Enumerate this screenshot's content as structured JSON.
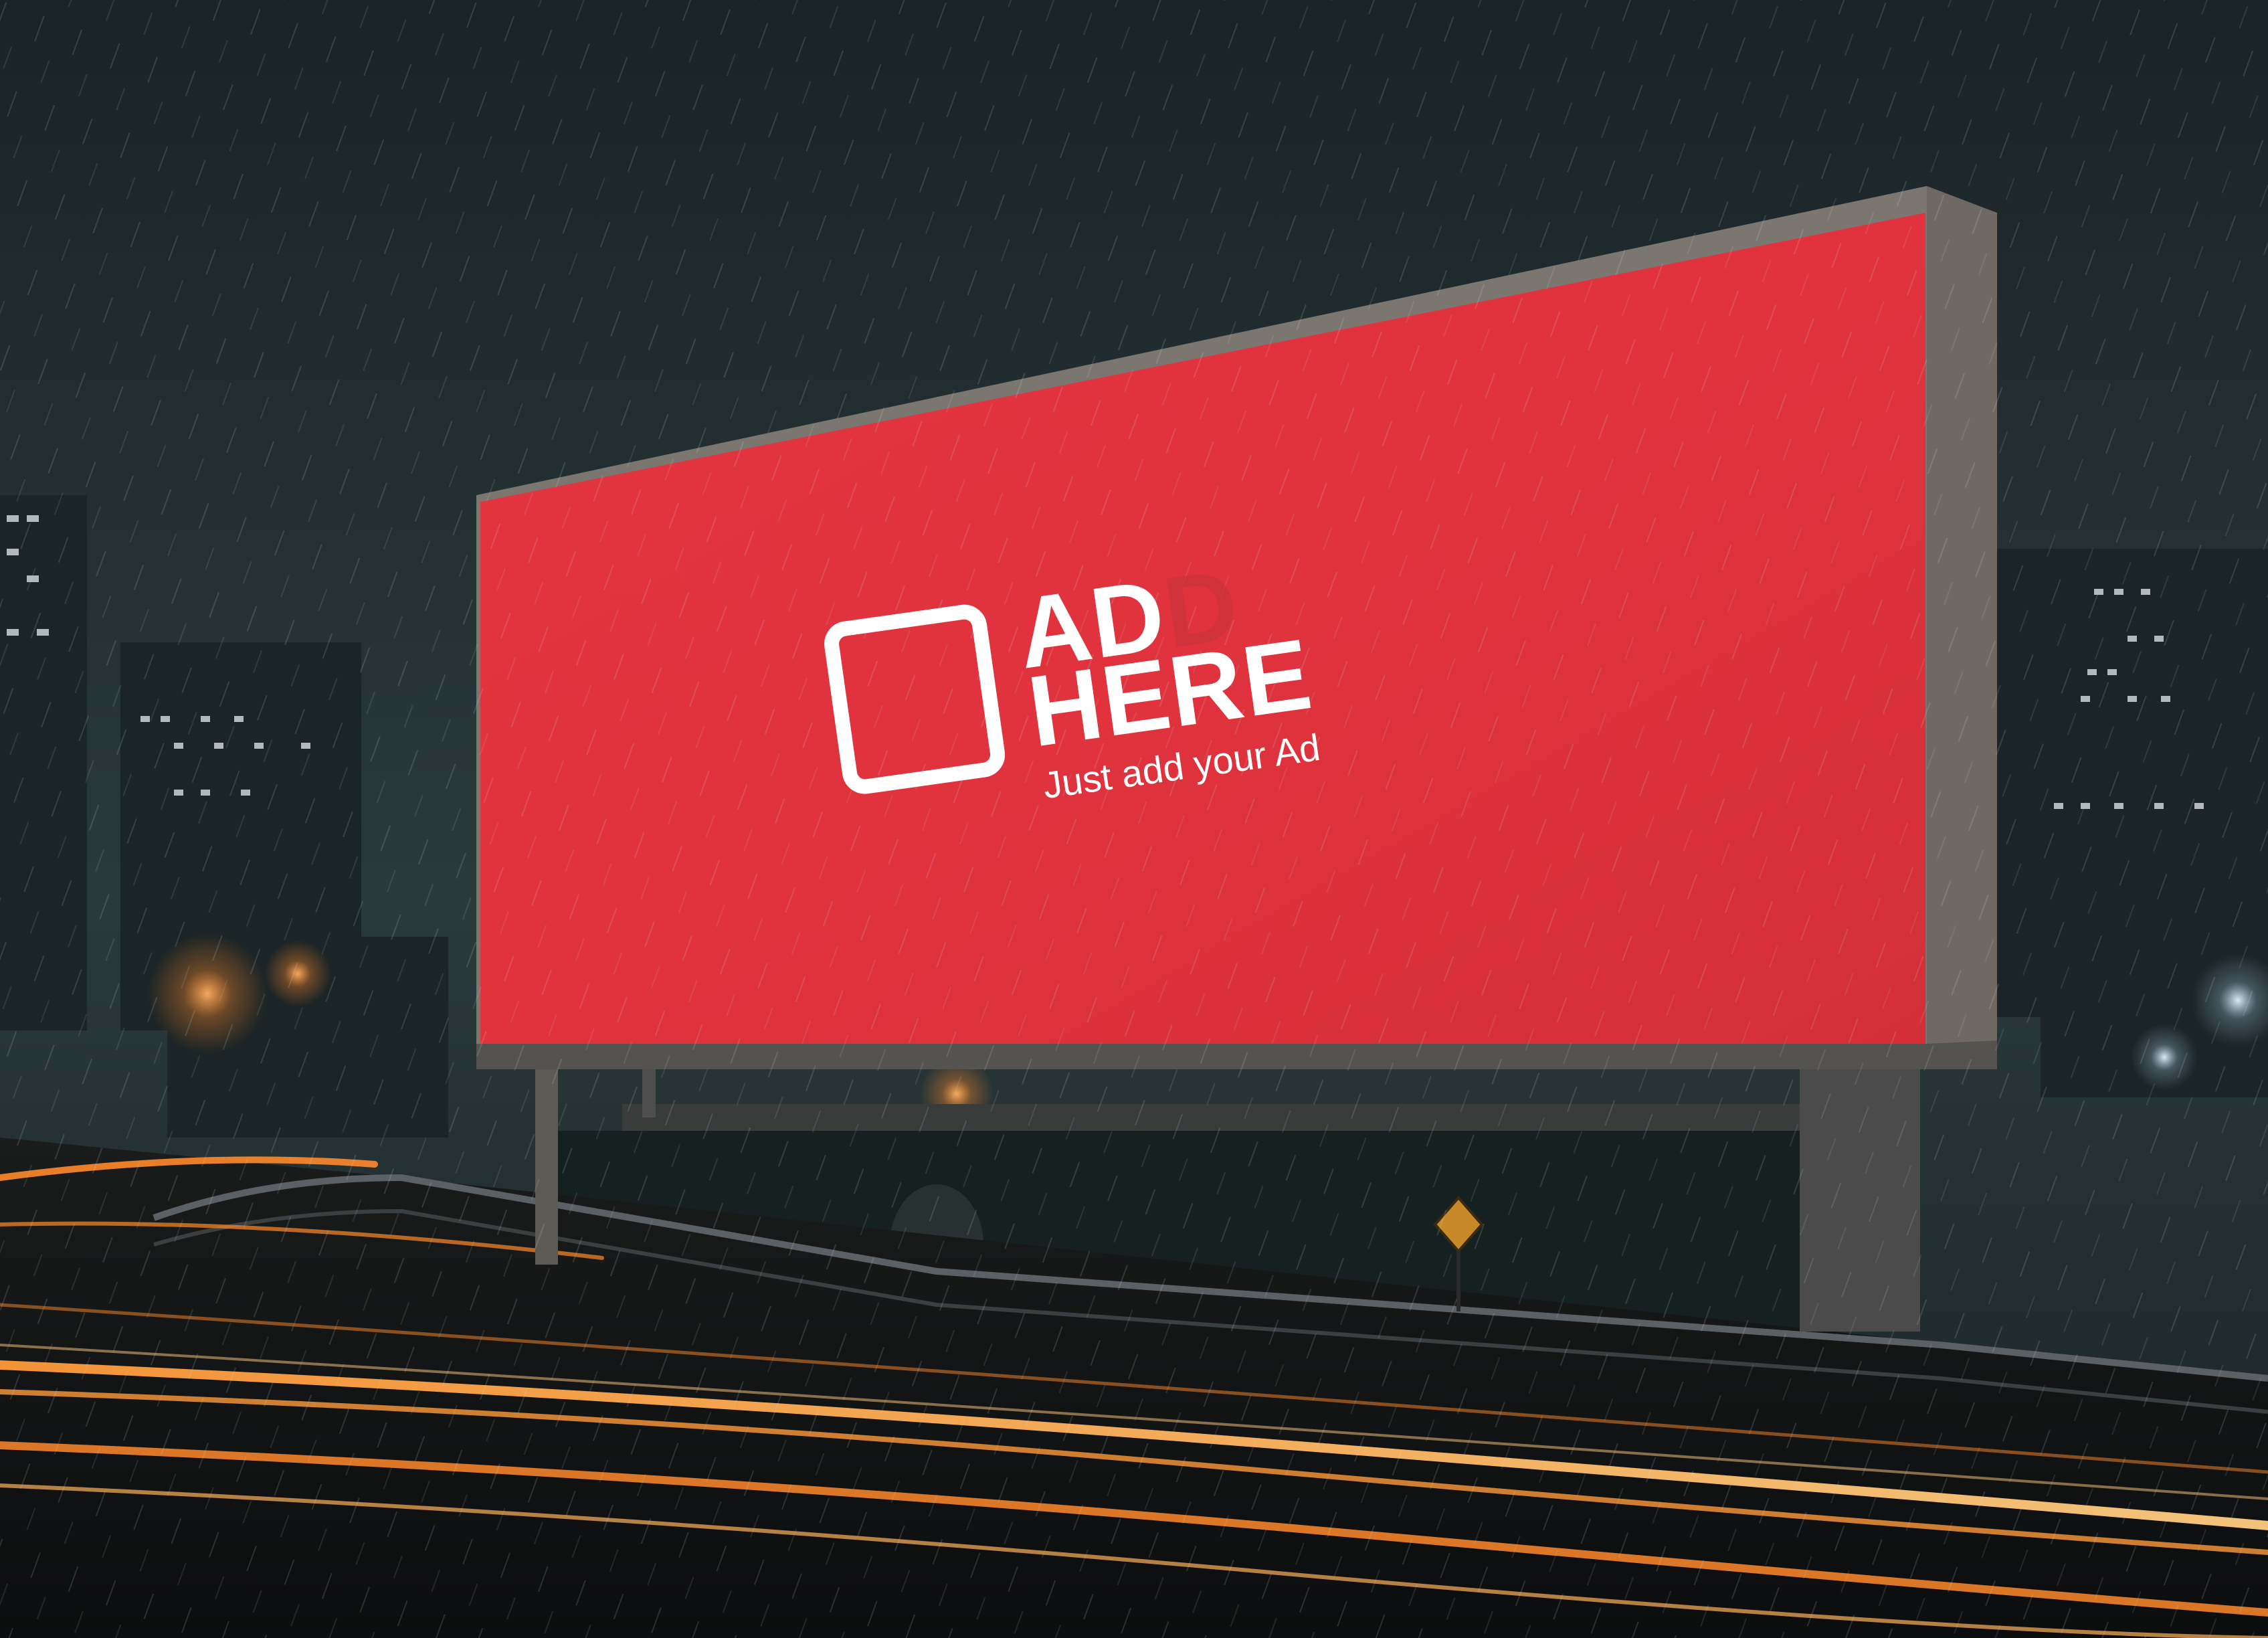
{
  "billboard": {
    "headline_line1_main": "AD",
    "headline_line1_ghost": "D",
    "headline_line2": "HERE",
    "tagline": "Just add your Ad",
    "icon": "rounded-square-icon"
  },
  "colors": {
    "billboard_red": "#e0333e",
    "sky": "#1d2a2c",
    "light_trail": "#ff8a2a",
    "ad_text": "#ffffff"
  }
}
